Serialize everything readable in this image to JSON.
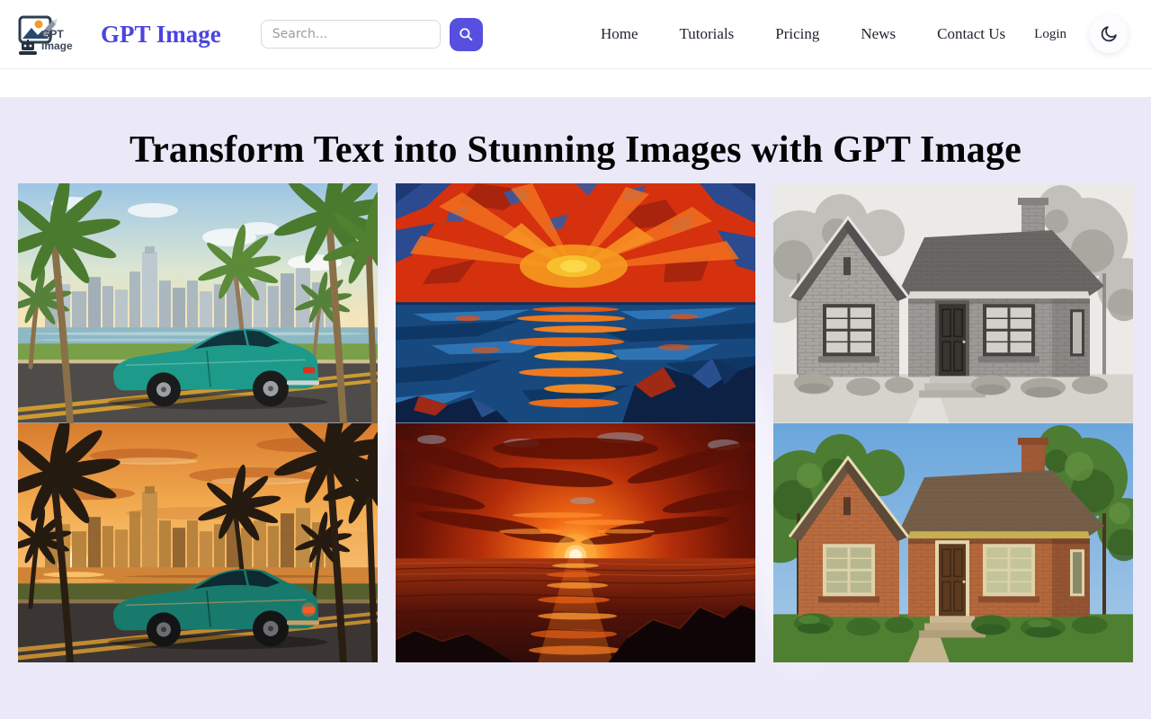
{
  "header": {
    "logo": {
      "icon": "gpt-image-logo-icon",
      "text_top": "GPT",
      "text_bottom": "Image"
    },
    "brand": "GPT Image",
    "search": {
      "placeholder": "Search...",
      "button_icon": "search-icon"
    },
    "nav": [
      {
        "label": "Home"
      },
      {
        "label": "Tutorials"
      },
      {
        "label": "Pricing"
      },
      {
        "label": "News"
      },
      {
        "label": "Contact Us"
      },
      {
        "label": "Login"
      }
    ],
    "theme_toggle": {
      "icon": "moon-icon"
    }
  },
  "hero": {
    "title": "Transform Text into Stunning Images with GPT Image"
  },
  "gallery": {
    "items": [
      {
        "name": "car-city-day",
        "alt": "Teal vintage car on a palm-lined coastal road with a city skyline in daylight"
      },
      {
        "name": "abstract-sunset-painting",
        "alt": "Abstract painting of a red and blue sunset over the ocean with dark rocks"
      },
      {
        "name": "house-pencil-sketch",
        "alt": "Pencil sketch of a small brick house with a chimney and front steps"
      },
      {
        "name": "car-city-sunset",
        "alt": "Teal vintage car on a palm-lined coastal road with a city skyline at sunset"
      },
      {
        "name": "ocean-sunset-photo",
        "alt": "Photorealistic fiery sunset over the ocean with dark rocks in the foreground"
      },
      {
        "name": "house-color-photo",
        "alt": "Color photo of a small red brick house with a chimney, lawn and bushes"
      }
    ]
  },
  "colors": {
    "accent": "#564fe0",
    "brand_text": "#4b44df",
    "header_bg": "#ffffff",
    "section_bg": "#ebe8f8",
    "title_text": "#000000",
    "nav_text": "#20252e"
  }
}
